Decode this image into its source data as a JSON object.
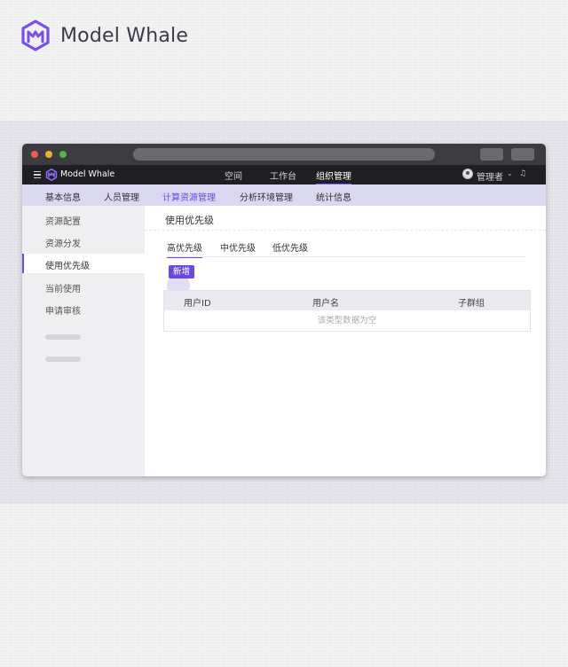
{
  "brand": {
    "name": "Model Whale"
  },
  "top_nav": {
    "brand": "Model Whale",
    "items": [
      {
        "label": "空间"
      },
      {
        "label": "工作台"
      },
      {
        "label": "组织管理",
        "active": true
      }
    ],
    "user": "管理者"
  },
  "sub_nav": {
    "items": [
      {
        "label": "基本信息"
      },
      {
        "label": "人员管理"
      },
      {
        "label": "计算资源管理",
        "active": true
      },
      {
        "label": "分析环境管理"
      },
      {
        "label": "统计信息"
      }
    ]
  },
  "sidebar": {
    "items": [
      {
        "label": "资源配置"
      },
      {
        "label": "资源分发"
      },
      {
        "label": "使用优先级",
        "active": true
      },
      {
        "label": "当前使用"
      },
      {
        "label": "申请审核"
      }
    ]
  },
  "main": {
    "title": "使用优先级",
    "tabs": [
      {
        "label": "高优先级",
        "active": true
      },
      {
        "label": "中优先级"
      },
      {
        "label": "低优先级"
      }
    ],
    "add_button": "新增",
    "table": {
      "columns": [
        "用户ID",
        "用户名",
        "子群组"
      ],
      "empty_text": "该类型数据为空"
    }
  },
  "colors": {
    "accent": "#6a48e8",
    "subnav_bg": "#dad8f0",
    "topnav_bg": "#1f1f24"
  }
}
